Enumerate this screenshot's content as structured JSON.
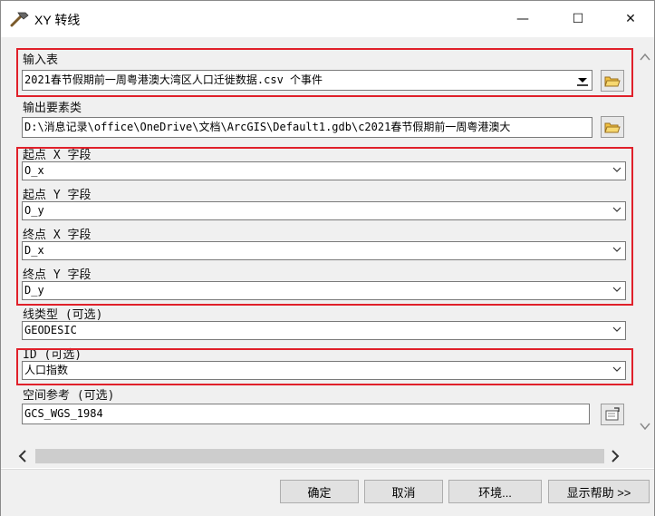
{
  "window": {
    "title": "XY 转线"
  },
  "titlebar": {
    "minimize": "—",
    "maximize": "☐",
    "close": "✕"
  },
  "fields": {
    "input_table": {
      "label": "输入表",
      "value": "2021春节假期前一周粤港澳大湾区人口迁徙数据.csv 个事件"
    },
    "output_features": {
      "label": "输出要素类",
      "value": "D:\\消息记录\\office\\OneDrive\\文档\\ArcGIS\\Default1.gdb\\c2021春节假期前一周粤港澳大"
    },
    "start_x": {
      "label": "起点 X 字段",
      "value": "O_x"
    },
    "start_y": {
      "label": "起点 Y 字段",
      "value": "O_y"
    },
    "end_x": {
      "label": "终点 X 字段",
      "value": "D_x"
    },
    "end_y": {
      "label": "终点 Y 字段",
      "value": "D_y"
    },
    "line_type": {
      "label": "线类型 (可选)",
      "value": "GEODESIC"
    },
    "id": {
      "label": "ID (可选)",
      "value": "人口指数"
    },
    "spatial_ref": {
      "label": "空间参考 (可选)",
      "value": "GCS_WGS_1984"
    }
  },
  "buttons": {
    "ok": "确定",
    "cancel": "取消",
    "environments": "环境...",
    "show_help": "显示帮助 >>"
  },
  "colors": {
    "highlight": "#e0202a",
    "background": "#f0f0f0"
  },
  "icons": [
    "hammer-icon",
    "folder-open-icon",
    "browse-icon",
    "chevron-down-icon",
    "scroll-up-icon",
    "scroll-down-icon",
    "scroll-left-icon",
    "scroll-right-icon"
  ]
}
